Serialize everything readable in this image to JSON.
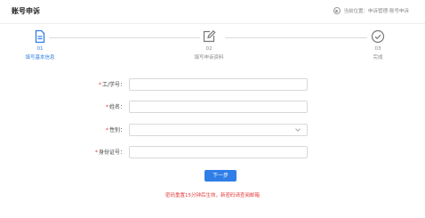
{
  "header": {
    "title": "账号申诉",
    "breadcrumb": "当前位置：申诉管理-账号申诉"
  },
  "steps": [
    {
      "number": "01",
      "label": "填写基本信息",
      "icon": "document-icon",
      "state": "active"
    },
    {
      "number": "02",
      "label": "填写申诉资料",
      "icon": "edit-icon",
      "state": "todo"
    },
    {
      "number": "03",
      "label": "完成",
      "icon": "check-circle-icon",
      "state": "todo"
    }
  ],
  "form": {
    "required_mark": "*",
    "fields": [
      {
        "label": "工/学号：",
        "value": ""
      },
      {
        "label": "姓名：",
        "value": ""
      },
      {
        "label": "性别：",
        "value": ""
      },
      {
        "label": "身份证号：",
        "value": ""
      }
    ],
    "next_label": "下一步"
  },
  "notice": "密码重置15分钟后生效，新密码请查阅邮箱",
  "colors": {
    "accent": "#2f7ee7",
    "required": "#e23c3c",
    "muted": "#888888"
  }
}
